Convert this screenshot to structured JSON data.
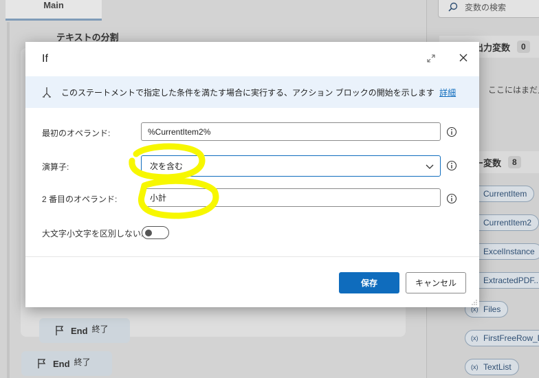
{
  "background": {
    "tab_main": "Main",
    "action_title": "テキストの分割",
    "end_blocks": [
      {
        "label": "End",
        "suffix": "終了"
      },
      {
        "label": "End",
        "suffix": "終了"
      }
    ],
    "search_placeholder": "変数の検索",
    "io_section": {
      "title": "入出力変数",
      "count": "0"
    },
    "io_empty_note": "ここにはまだ入力",
    "flow_section": {
      "title": "ロー変数",
      "count": "8"
    },
    "flow_variables": [
      "CurrentItem",
      "CurrentItem2",
      "ExcelInstance",
      "ExtractedPDF...",
      "Files",
      "FirstFreeRow_D",
      "TextList"
    ],
    "var_chip_marker": "(x)"
  },
  "dialog": {
    "title": "If",
    "info_text": "このステートメントで指定した条件を満たす場合に実行する、アクション ブロックの開始を示します",
    "info_link": "詳細",
    "fields": {
      "first_operand": {
        "label": "最初のオペランド:",
        "value": "%CurrentItem2%"
      },
      "operator": {
        "label": "演算子:",
        "value": "次を含む"
      },
      "second_operand": {
        "label": "2 番目のオペランド:",
        "value": "小計"
      },
      "ignore_case": {
        "label": "大文字小文字を区別しない:",
        "enabled": false
      }
    },
    "buttons": {
      "save": "保存",
      "cancel": "キャンセル"
    }
  },
  "colors": {
    "primary": "#0f6cbd",
    "highlighter": "#f7f700",
    "info_band": "#eaf2fb"
  }
}
